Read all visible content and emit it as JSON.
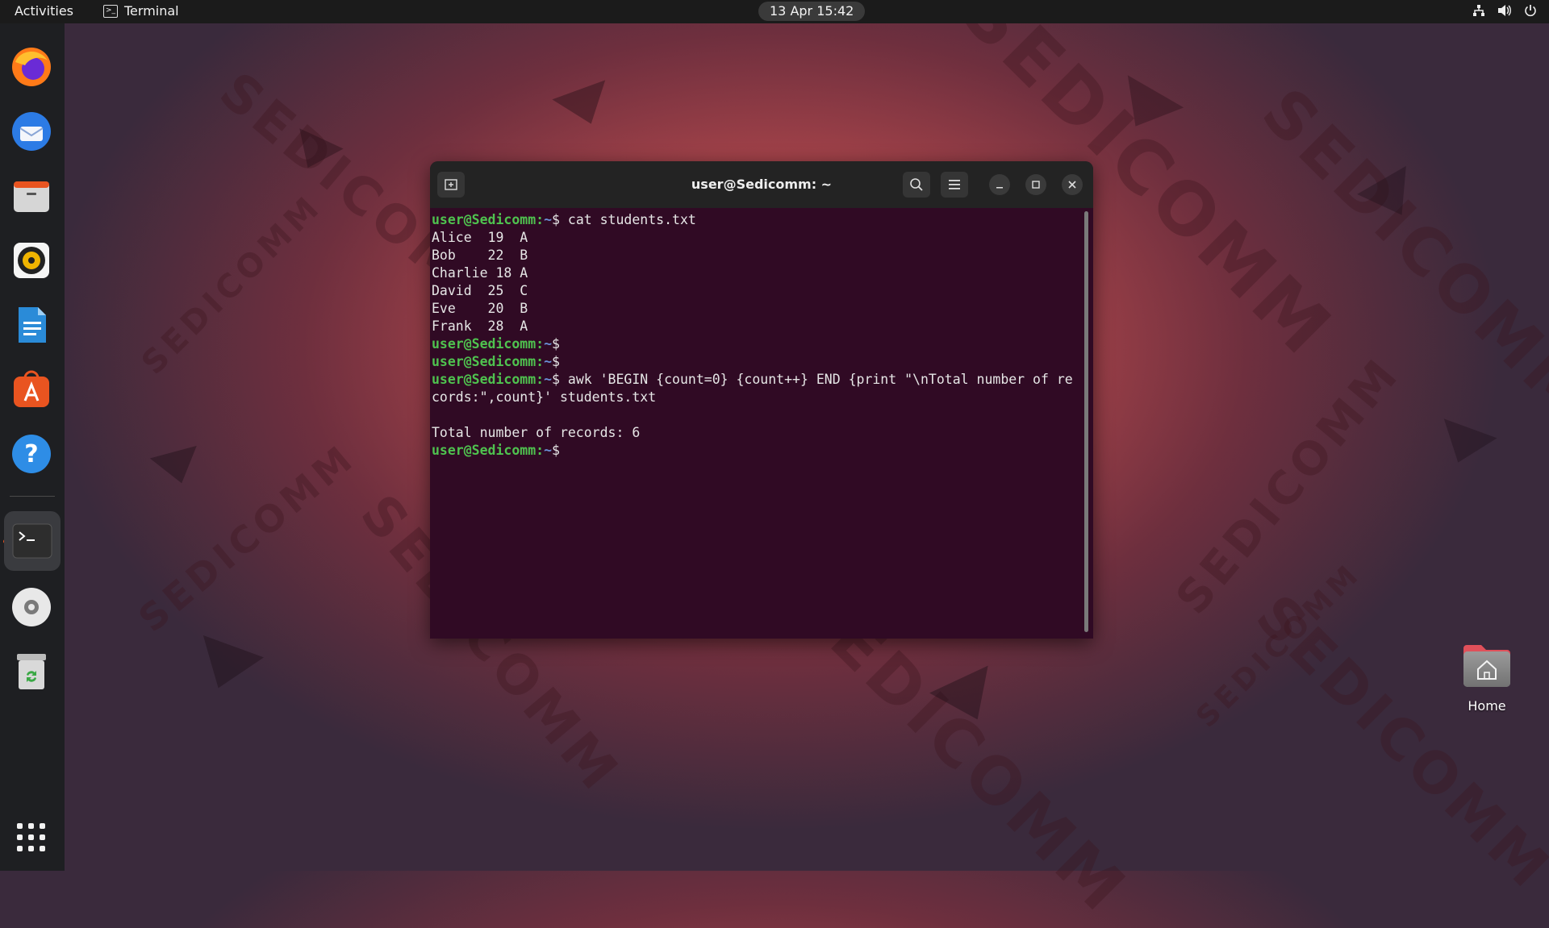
{
  "topbar": {
    "activities": "Activities",
    "app_name": "Terminal",
    "clock": "13 Apr  15:42",
    "icons": [
      "network-icon",
      "volume-icon",
      "power-icon"
    ]
  },
  "dock": {
    "items": [
      {
        "name": "firefox-icon"
      },
      {
        "name": "thunderbird-icon"
      },
      {
        "name": "files-icon"
      },
      {
        "name": "rhythmbox-icon"
      },
      {
        "name": "libreoffice-writer-icon"
      },
      {
        "name": "app-center-icon"
      },
      {
        "name": "help-icon"
      },
      {
        "name": "terminal-icon",
        "running": true
      },
      {
        "name": "optical-disc-icon"
      },
      {
        "name": "trash-icon"
      },
      {
        "name": "show-apps-icon"
      }
    ]
  },
  "terminal": {
    "title": "user@Sedicomm: ~",
    "prompt_user": "user@Sedicomm:",
    "prompt_path": "~",
    "prompt_symbol": "$",
    "lines": [
      {
        "type": "cmd",
        "text": " cat students.txt"
      },
      {
        "type": "out",
        "text": "Alice  19  A"
      },
      {
        "type": "out",
        "text": "Bob    22  B"
      },
      {
        "type": "out",
        "text": "Charlie 18 A"
      },
      {
        "type": "out",
        "text": "David  25  C"
      },
      {
        "type": "out",
        "text": "Eve    20  B"
      },
      {
        "type": "out",
        "text": "Frank  28  A"
      },
      {
        "type": "cmd",
        "text": ""
      },
      {
        "type": "cmd",
        "text": ""
      },
      {
        "type": "cmd",
        "text": " awk 'BEGIN {count=0} {count++} END {print \"\\nTotal number of re"
      },
      {
        "type": "out",
        "text": "cords:\",count}' students.txt"
      },
      {
        "type": "out",
        "text": ""
      },
      {
        "type": "out",
        "text": "Total number of records: 6"
      },
      {
        "type": "cmd",
        "text": ""
      }
    ]
  },
  "desktop": {
    "home_label": "Home",
    "watermark": "SEDICOMM"
  },
  "colors": {
    "terminal_bg": "#300a24",
    "prompt_user": "#4fc24f",
    "prompt_path": "#6a8fd6",
    "accent": "#e95420"
  }
}
